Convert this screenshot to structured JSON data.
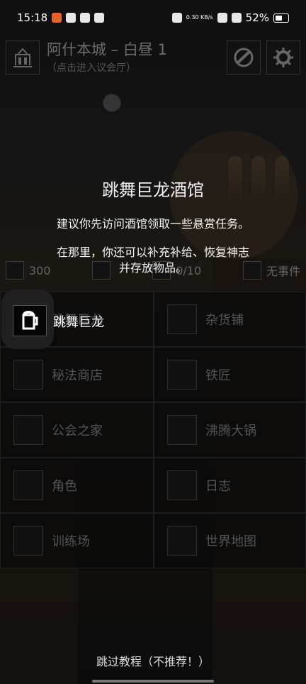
{
  "status": {
    "time": "15:18",
    "network": "0.30 KB/s",
    "battery": "52%"
  },
  "city": {
    "title": "阿什本城 – 白昼 1",
    "subtitle": "（点击进入议会厅）"
  },
  "modal": {
    "title": "跳舞巨龙酒馆",
    "line1": "建议你先访问酒馆领取一些悬赏任务。",
    "line2": "在那里，你还可以补充补给、恢复神志",
    "line3": "并存放物品。"
  },
  "stats": {
    "gold": "300",
    "slots": "0/10",
    "event": "无事件"
  },
  "tiles": [
    {
      "label": "跳舞巨龙",
      "icon": "tavern-mug-icon"
    },
    {
      "label": "杂货铺",
      "icon": "scales-icon"
    },
    {
      "label": "秘法商店",
      "icon": "book-icon"
    },
    {
      "label": "铁匠",
      "icon": "anvil-icon"
    },
    {
      "label": "公会之家",
      "icon": "hand-crest-icon"
    },
    {
      "label": "沸腾大锅",
      "icon": "cauldron-icon"
    },
    {
      "label": "角色",
      "icon": "helmet-icon"
    },
    {
      "label": "日志",
      "icon": "journal-icon"
    },
    {
      "label": "训练场",
      "icon": "training-icon"
    },
    {
      "label": "世界地图",
      "icon": "map-icon"
    }
  ],
  "skip_tutorial": "跳过教程（不推荐！）"
}
